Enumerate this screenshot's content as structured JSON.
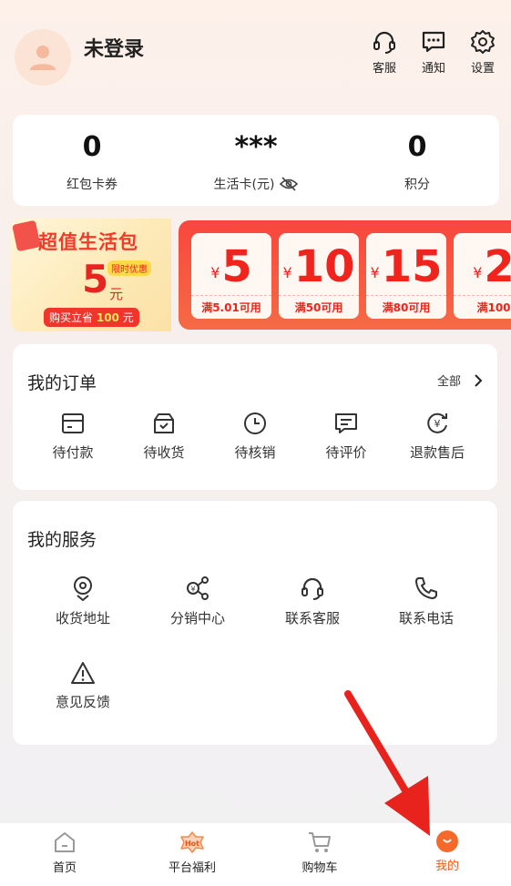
{
  "header": {
    "username": "未登录",
    "service_label": "客服",
    "notify_label": "通知",
    "settings_label": "设置"
  },
  "stats": [
    {
      "value": "0",
      "label": "红包卡券"
    },
    {
      "value": "***",
      "label": "生活卡(元)"
    },
    {
      "value": "0",
      "label": "积分"
    }
  ],
  "promo": {
    "title": "超值生活包",
    "amount": "5",
    "unit": "元",
    "tag": "限时优惠",
    "buy_prefix": "购买立省",
    "buy_amount": "100",
    "buy_suffix": "元"
  },
  "coupons": [
    {
      "currency": "¥",
      "amount": "5",
      "condition": "满5.01可用"
    },
    {
      "currency": "¥",
      "amount": "10",
      "condition": "满50可用"
    },
    {
      "currency": "¥",
      "amount": "15",
      "condition": "满80可用"
    },
    {
      "currency": "¥",
      "amount": "2",
      "condition": "满100"
    }
  ],
  "orders": {
    "title": "我的订单",
    "more_label": "全部",
    "items": [
      {
        "label": "待付款",
        "icon": "wallet-icon"
      },
      {
        "label": "待收货",
        "icon": "package-icon"
      },
      {
        "label": "待核销",
        "icon": "clock-icon"
      },
      {
        "label": "待评价",
        "icon": "comment-icon"
      },
      {
        "label": "退款售后",
        "icon": "refund-icon"
      }
    ]
  },
  "services": {
    "title": "我的服务",
    "items": [
      {
        "label": "收货地址",
        "icon": "location-icon"
      },
      {
        "label": "分销中心",
        "icon": "share-icon"
      },
      {
        "label": "联系客服",
        "icon": "headset-icon"
      },
      {
        "label": "联系电话",
        "icon": "phone-icon"
      },
      {
        "label": "意见反馈",
        "icon": "warning-icon"
      }
    ]
  },
  "tabbar": {
    "items": [
      {
        "label": "首页",
        "icon": "home-icon"
      },
      {
        "label": "平台福利",
        "icon": "hot-icon"
      },
      {
        "label": "购物车",
        "icon": "cart-icon"
      },
      {
        "label": "我的",
        "icon": "me-icon"
      }
    ],
    "active_color": "#f05a1a",
    "hot_badge": "Hot"
  },
  "colors": {
    "accent": "#f0241c",
    "coupon_bg": "#f9463d"
  }
}
